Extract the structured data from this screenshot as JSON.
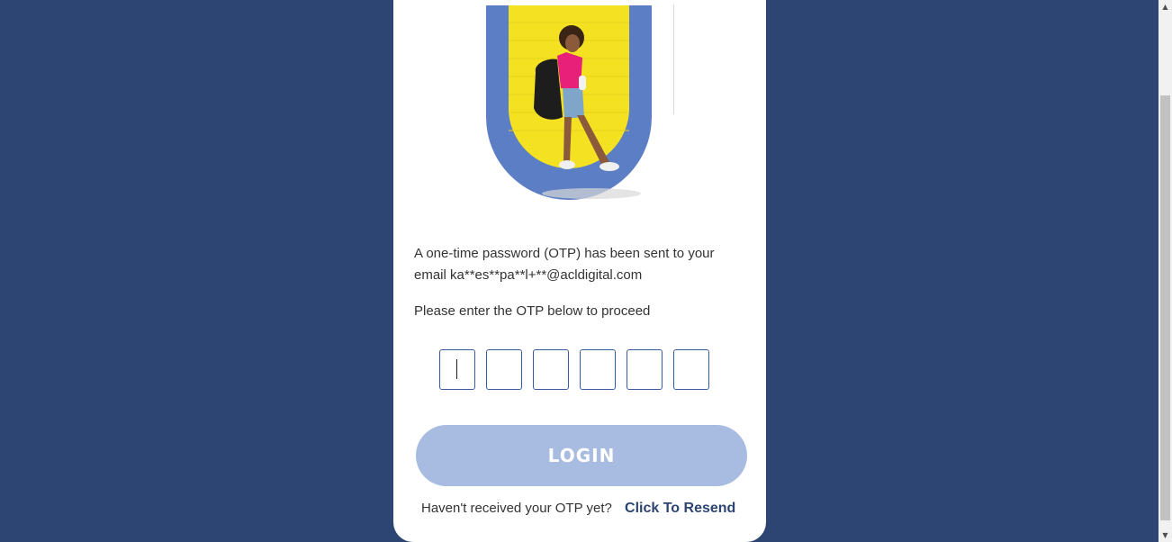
{
  "otp": {
    "message_line1": "A one-time password (OTP) has been sent to your",
    "message_line2": "email ka**es**pa**l+**@acldigital.com",
    "instruction": "Please enter the OTP below to proceed",
    "digits": [
      "",
      "",
      "",
      "",
      "",
      ""
    ]
  },
  "login": {
    "button_label": "LOGIN"
  },
  "resend": {
    "prompt": "Haven't received your OTP yet?",
    "link_label": "Click To Resend"
  },
  "colors": {
    "page_bg": "#2c4572",
    "card_bg": "#ffffff",
    "login_button_bg": "#a8bbe1",
    "accent_blue": "#5b7ec4",
    "accent_yellow": "#f4e222",
    "link": "#2c4572"
  },
  "icons": {
    "scroll_up": "scroll-up-arrow-icon",
    "scroll_down": "scroll-down-arrow-icon"
  }
}
